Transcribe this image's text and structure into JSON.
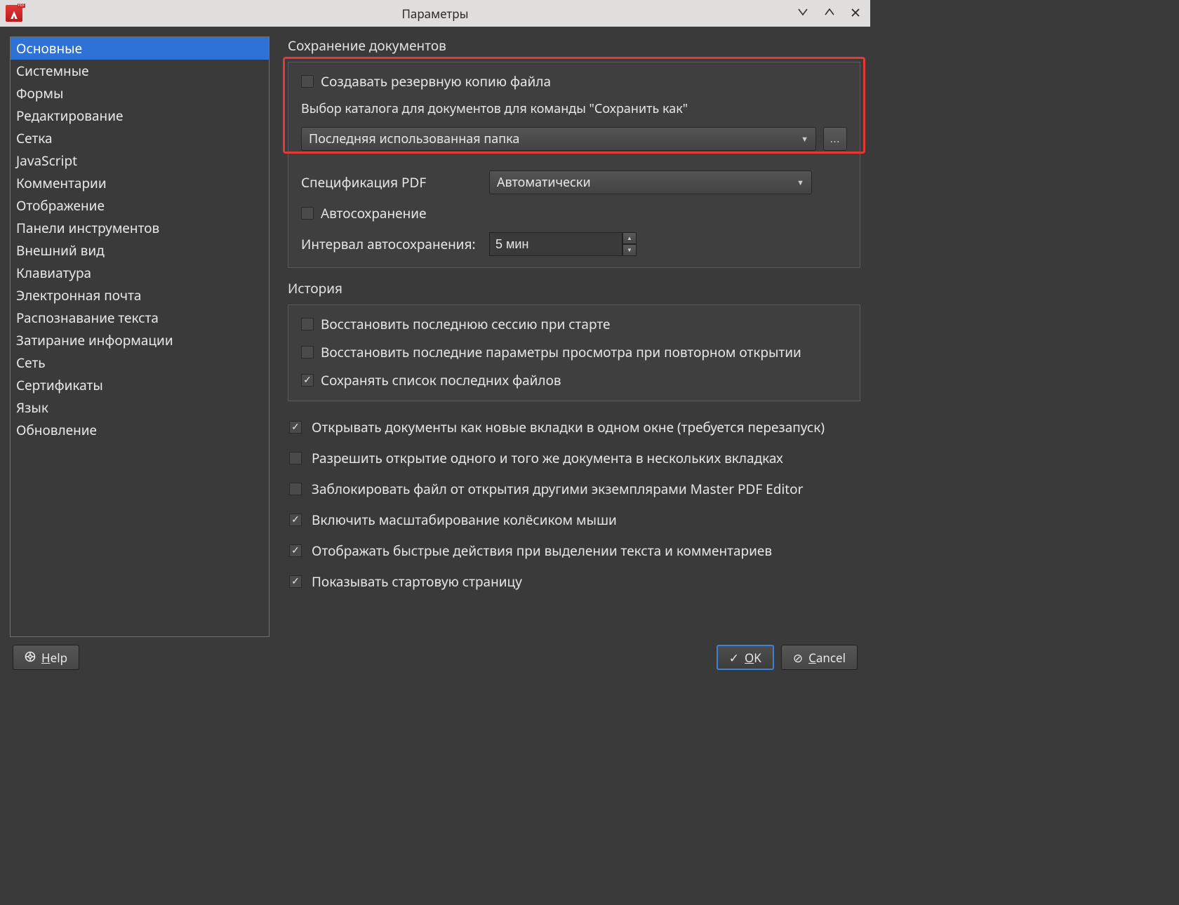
{
  "window": {
    "title": "Параметры"
  },
  "sidebar": {
    "items": [
      "Основные",
      "Системные",
      "Формы",
      "Редактирование",
      "Сетка",
      "JavaScript",
      "Комментарии",
      "Отображение",
      "Панели инструментов",
      "Внешний вид",
      "Клавиатура",
      "Электронная почта",
      "Распознавание текста",
      "Затирание информации",
      "Сеть",
      "Сертификаты",
      "Язык",
      "Обновление"
    ],
    "selected": 0
  },
  "sections": {
    "save": {
      "title": "Сохранение документов",
      "backup_label": "Создавать резервную копию файла",
      "saveas_dir_label": "Выбор каталога для документов для команды \"Сохранить как\"",
      "saveas_dir_value": "Последняя использованная папка",
      "browse_label": "...",
      "pdfspec_label": "Спецификация PDF",
      "pdfspec_value": "Автоматически",
      "autosave_label": "Автосохранение",
      "autosave_interval_label": "Интервал автосохранения:",
      "autosave_interval_value": "5 мин"
    },
    "history": {
      "title": "История",
      "restore_session": "Восстановить последнюю сессию при старте",
      "restore_view": "Восстановить последние параметры просмотра при повторном открытии",
      "keep_recent": "Сохранять список последних файлов"
    },
    "misc": {
      "tabs": "Открывать документы как новые вкладки в одном окне (требуется перезапуск)",
      "multi_open": "Разрешить открытие одного и того же документа в нескольких вкладках",
      "lock_file": "Заблокировать файл от открытия другими экземплярами Master PDF Editor",
      "wheel_zoom": "Включить масштабирование колёсиком мыши",
      "quick_actions": "Отображать быстрые действия при выделении текста и комментариев",
      "start_page": "Показывать стартовую страницу"
    }
  },
  "buttons": {
    "help_prefix": "H",
    "help_rest": "elp",
    "ok_prefix": "O",
    "ok_rest": "K",
    "cancel_prefix": "C",
    "cancel_rest": "ancel"
  },
  "checks": {
    "backup": false,
    "autosave": false,
    "restore_session": false,
    "restore_view": false,
    "keep_recent": true,
    "tabs": true,
    "multi_open": false,
    "lock_file": false,
    "wheel_zoom": true,
    "quick_actions": true,
    "start_page": true
  }
}
